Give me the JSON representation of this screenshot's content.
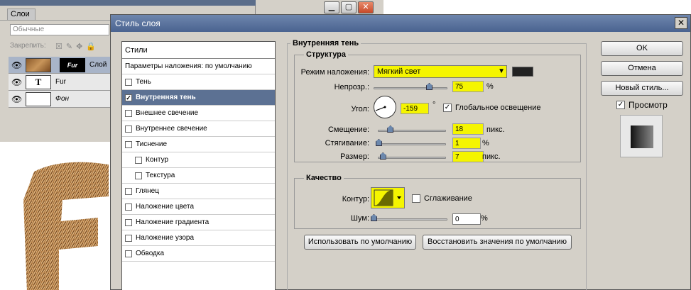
{
  "layers_panel": {
    "tab_label": "Слои",
    "blend_mode": "Обычные",
    "lock_label": "Закрепить:",
    "layers": [
      {
        "name": "Слой",
        "mask_label": "Fur",
        "active": true
      },
      {
        "name": "Fur",
        "type_glyph": "T",
        "active": false
      },
      {
        "name": "Фон",
        "active": false
      }
    ]
  },
  "dialog": {
    "title": "Стиль слоя",
    "close_glyph": "✕",
    "styles_header": "Стили",
    "styles": [
      {
        "label": "Параметры наложения: по умолчанию",
        "check": false,
        "header": true
      },
      {
        "label": "Тень",
        "check": true,
        "checked": false
      },
      {
        "label": "Внутренняя тень",
        "check": true,
        "checked": true,
        "selected": true
      },
      {
        "label": "Внешнее свечение",
        "check": true,
        "checked": false
      },
      {
        "label": "Внутреннее свечение",
        "check": true,
        "checked": false
      },
      {
        "label": "Тиснение",
        "check": true,
        "checked": false
      },
      {
        "label": "Контур",
        "check": true,
        "checked": false,
        "sub": true
      },
      {
        "label": "Текстура",
        "check": true,
        "checked": false,
        "sub": true
      },
      {
        "label": "Глянец",
        "check": true,
        "checked": false
      },
      {
        "label": "Наложение цвета",
        "check": true,
        "checked": false
      },
      {
        "label": "Наложение градиента",
        "check": true,
        "checked": false
      },
      {
        "label": "Наложение узора",
        "check": true,
        "checked": false
      },
      {
        "label": "Обводка",
        "check": true,
        "checked": false
      }
    ],
    "inner_shadow_title": "Внутренняя тень",
    "structure_title": "Структура",
    "blend_mode_label": "Режим наложения:",
    "blend_mode_value": "Мягкий свет",
    "opacity_label": "Непрозр.:",
    "opacity_value": "75",
    "opacity_unit": "%",
    "angle_label": "Угол:",
    "angle_value": "-159",
    "angle_unit": "°",
    "global_light_label": "Глобальное освещение",
    "distance_label": "Смещение:",
    "distance_value": "18",
    "distance_unit": "пикс.",
    "choke_label": "Стягивание:",
    "choke_value": "1",
    "choke_unit": "%",
    "size_label": "Размер:",
    "size_value": "7",
    "size_unit": "пикс.",
    "quality_title": "Качество",
    "contour_label": "Контур:",
    "antialias_label": "Сглаживание",
    "noise_label": "Шум:",
    "noise_value": "0",
    "noise_unit": "%",
    "use_default_button": "Использовать по умолчанию",
    "reset_default_button": "Восстановить значения по умолчанию",
    "ok_button": "OK",
    "cancel_button": "Отмена",
    "new_style_button": "Новый стиль...",
    "preview_label": "Просмотр",
    "slider_levels": {
      "opacity": 0.75,
      "distance": 0.18,
      "choke": 0.01,
      "size": 0.07,
      "noise": 0.0
    }
  },
  "colors": {
    "highlight": "#f5f500",
    "selection": "#5c7193",
    "titlebar": "#4a6390",
    "shadow_color": "#222222"
  }
}
